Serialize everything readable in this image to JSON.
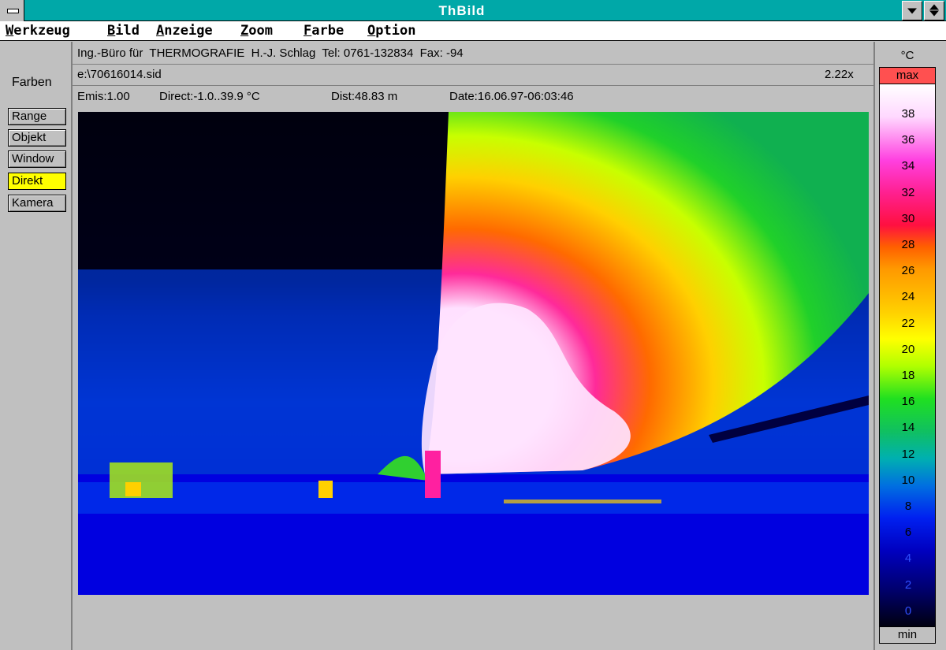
{
  "window": {
    "title": "ThBild"
  },
  "menu": [
    {
      "mnemonic": "W",
      "rest": "erkzeug"
    },
    {
      "mnemonic": "B",
      "rest": "ild"
    },
    {
      "mnemonic": "A",
      "rest": "nzeige"
    },
    {
      "mnemonic": "Z",
      "rest": "oom"
    },
    {
      "mnemonic": "F",
      "rest": "arbe"
    },
    {
      "mnemonic": "O",
      "rest": "ption"
    }
  ],
  "header": {
    "company": "Ing.-Büro für  THERMOGRAFIE  H.-J. Schlag  Tel: 0761-132834  Fax: -94",
    "file": "e:\\70616014.sid",
    "zoom": "2.22x",
    "emis": "Emis:1.00",
    "direct": "Direct:-1.0..39.9 °C",
    "dist": "Dist:48.83 m",
    "date": "Date:16.06.97-06:03:46"
  },
  "left_panel": {
    "label": "Farben",
    "buttons": [
      "Range",
      "Objekt",
      "Window",
      "Direkt",
      "Kamera"
    ],
    "active_button": "Direkt"
  },
  "scale": {
    "unit": "°C",
    "max_label": "max",
    "min_label": "min",
    "ticks": [
      "38",
      "36",
      "34",
      "32",
      "30",
      "28",
      "26",
      "24",
      "22",
      "20",
      "18",
      "16",
      "14",
      "12",
      "10",
      "8",
      "6",
      "4",
      "2",
      "0"
    ]
  },
  "colors": {
    "titlebar": "#00a8a8",
    "active_button": "#ffff00",
    "max_box": "#ff5050"
  }
}
